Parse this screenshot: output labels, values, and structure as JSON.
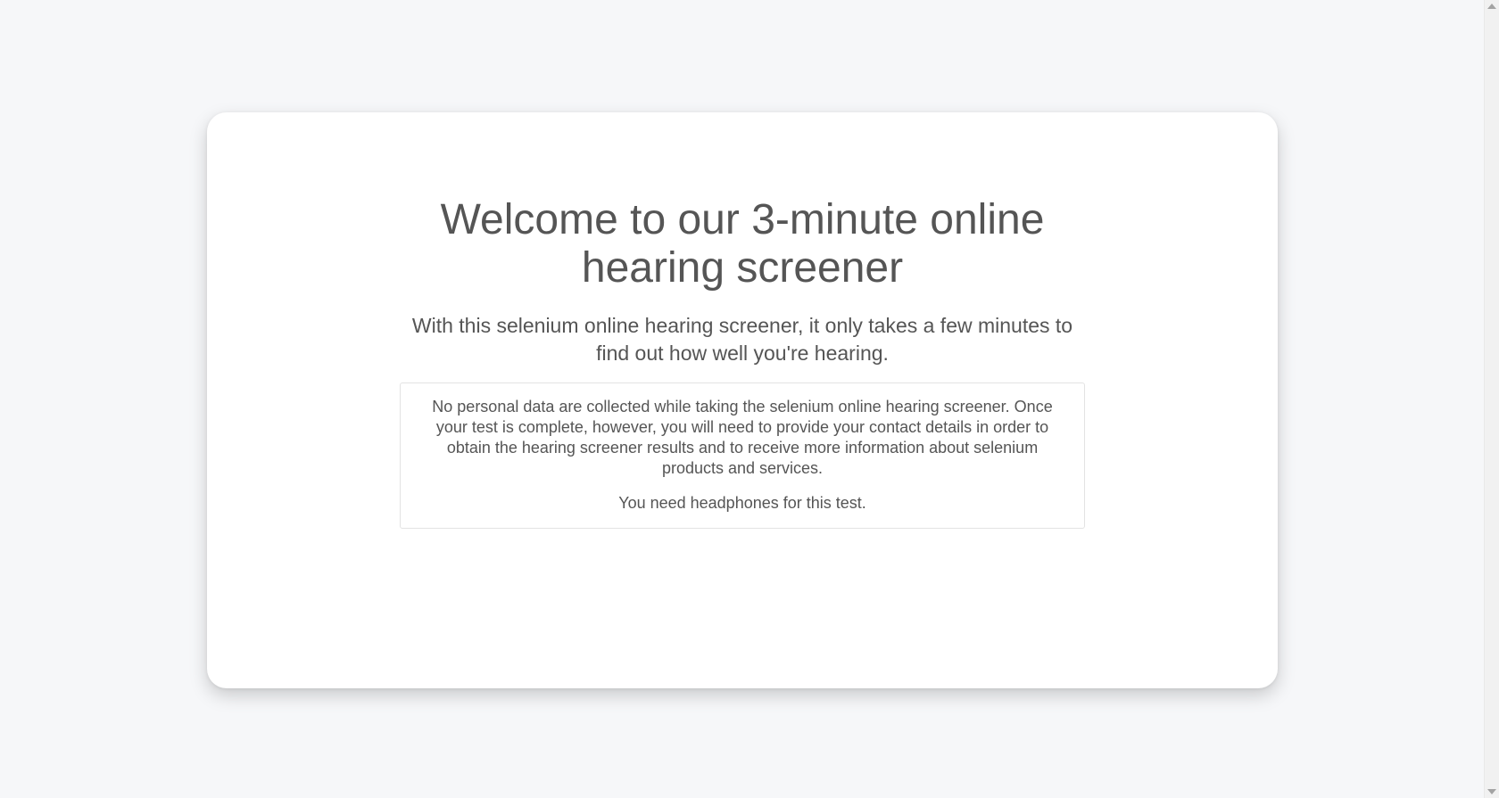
{
  "screener": {
    "title": "Welcome to our 3-minute online hearing screener",
    "subtitle": "With this selenium online hearing screener, it only takes a few minutes to find out how well you're hearing.",
    "privacy_notice": "No personal data are collected while taking the selenium online hearing screener. Once your test is complete, however, you will need to provide your contact details in order to obtain the hearing screener results and to receive more information about selenium products and services.",
    "headphones_notice": "You need headphones for this test."
  },
  "colors": {
    "page_background": "#f6f7f9",
    "card_background": "#ffffff",
    "text": "#555555",
    "border": "#e3e3e3"
  },
  "icons": {
    "scroll_up": "scroll-up-arrow-icon",
    "scroll_down": "scroll-down-arrow-icon"
  }
}
